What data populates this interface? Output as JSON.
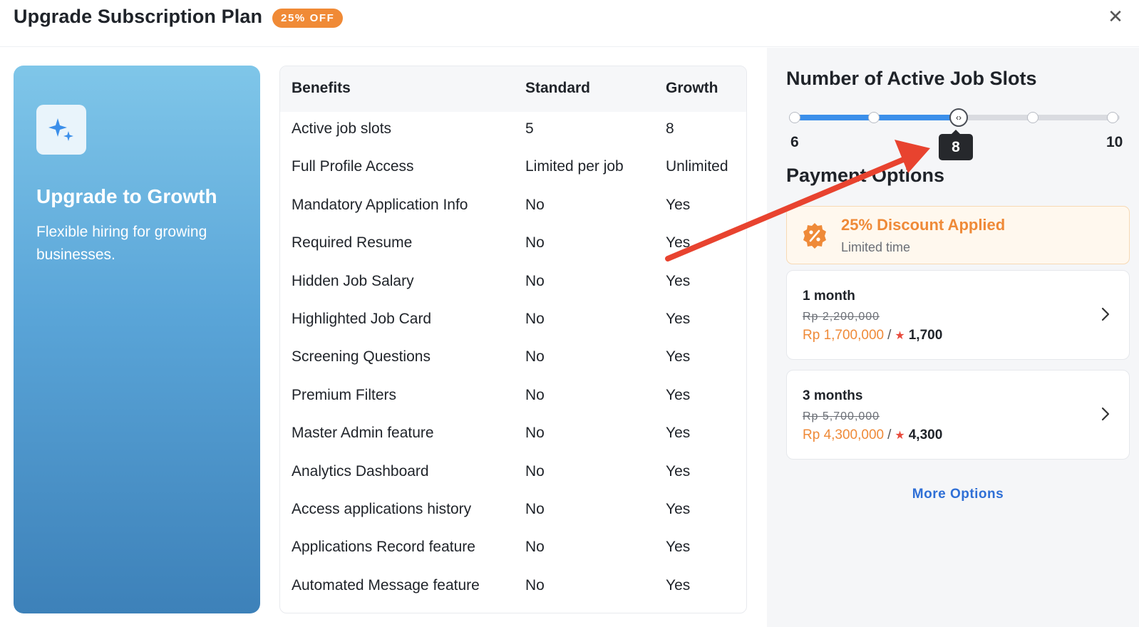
{
  "header": {
    "title": "Upgrade Subscription Plan",
    "badge": "25% OFF",
    "close_icon": "close-icon"
  },
  "promo": {
    "icon": "sparkle-icon",
    "title": "Upgrade to Growth",
    "subtitle": "Flexible hiring for growing businesses."
  },
  "benefits": {
    "headers": [
      "Benefits",
      "Standard",
      "Growth"
    ],
    "rows": [
      [
        "Active job slots",
        "5",
        "8"
      ],
      [
        "Full Profile Access",
        "Limited per job",
        "Unlimited"
      ],
      [
        "Mandatory Application Info",
        "No",
        "Yes"
      ],
      [
        "Required Resume",
        "No",
        "Yes"
      ],
      [
        "Hidden Job Salary",
        "No",
        "Yes"
      ],
      [
        "Highlighted Job Card",
        "No",
        "Yes"
      ],
      [
        "Screening Questions",
        "No",
        "Yes"
      ],
      [
        "Premium Filters",
        "No",
        "Yes"
      ],
      [
        "Master Admin feature",
        "No",
        "Yes"
      ],
      [
        "Analytics Dashboard",
        "No",
        "Yes"
      ],
      [
        "Access applications history",
        "No",
        "Yes"
      ],
      [
        "Applications Record feature",
        "No",
        "Yes"
      ],
      [
        "Automated Message feature",
        "No",
        "Yes"
      ]
    ]
  },
  "slots": {
    "title": "Number of Active Job Slots",
    "min": "6",
    "max": "10",
    "value": "8",
    "steps": [
      6,
      7,
      8,
      9,
      10
    ],
    "thumb_icon": "drag-handle-icon",
    "accent": "#3b8fea"
  },
  "payment": {
    "title": "Payment Options",
    "discount": {
      "icon": "percent-badge-icon",
      "title": "25% Discount Applied",
      "subtitle": "Limited time"
    },
    "plans": [
      {
        "name": "1 month",
        "old_price": "Rp 2,200,000",
        "price": "Rp 1,700,000",
        "separator": "/",
        "star": "★",
        "points": "1,700"
      },
      {
        "name": "3 months",
        "old_price": "Rp 5,700,000",
        "price": "Rp 4,300,000",
        "separator": "/",
        "star": "★",
        "points": "4,300"
      }
    ],
    "more_options": "More Options"
  },
  "annotation": {
    "arrow_color": "#e8432f"
  }
}
